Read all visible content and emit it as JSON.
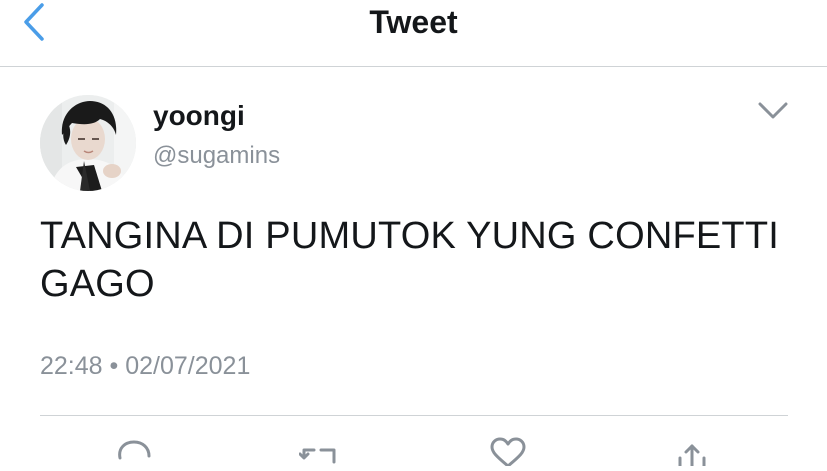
{
  "header": {
    "title": "Tweet",
    "back_icon": "chevron-left-icon",
    "accent_color": "#4a9de8"
  },
  "tweet": {
    "display_name": "yoongi",
    "handle": "@sugamins",
    "text": "TANGINA DI PUMUTOK YUNG CONFETTI GAGO",
    "time": "22:48",
    "separator": "•",
    "date": "02/07/2021",
    "menu_icon": "chevron-down-icon"
  },
  "actions": [
    {
      "icon": "reply-icon"
    },
    {
      "icon": "retweet-icon"
    },
    {
      "icon": "like-icon"
    },
    {
      "icon": "share-icon"
    }
  ]
}
